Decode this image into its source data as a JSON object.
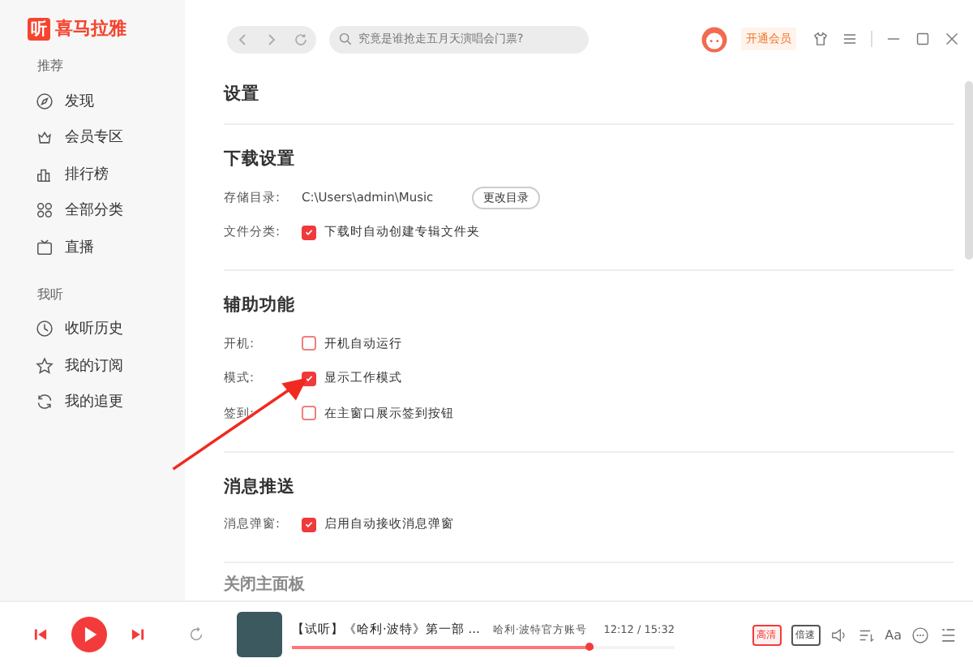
{
  "app": {
    "logo_mark": "听",
    "logo_text": "喜马拉雅"
  },
  "sidebar": {
    "groups": [
      {
        "title": "推荐",
        "items": [
          {
            "label": "发现",
            "selected": false
          },
          {
            "label": "会员专区",
            "selected": false
          },
          {
            "label": "排行榜",
            "selected": false
          },
          {
            "label": "全部分类",
            "selected": false
          },
          {
            "label": "直播",
            "selected": false
          }
        ]
      },
      {
        "title": "我听",
        "items": [
          {
            "label": "收听历史",
            "selected": false
          },
          {
            "label": "我的订阅",
            "selected": false
          },
          {
            "label": "我的追更",
            "selected": false
          }
        ]
      }
    ]
  },
  "topbar": {
    "search": {
      "placeholder": "究竟是谁抢走五月天演唱会门票?"
    },
    "vip_button": "开通会员"
  },
  "settings": {
    "title": "设置",
    "sections": [
      {
        "title": "下载设置",
        "rows": [
          {
            "kind": "path",
            "label": "存储目录:",
            "value": "C:\\Users\\admin\\Music",
            "button": "更改目录"
          },
          {
            "kind": "checkbox",
            "label": "文件分类:",
            "text": "下载时自动创建专辑文件夹",
            "checked": true
          }
        ]
      },
      {
        "title": "辅助功能",
        "rows": [
          {
            "kind": "checkbox",
            "label": "开机:",
            "text": "开机自动运行",
            "checked": false
          },
          {
            "kind": "checkbox",
            "label": "模式:",
            "text": "显示工作模式",
            "checked": true
          },
          {
            "kind": "checkbox",
            "label": "签到:",
            "text": "在主窗口展示签到按钮",
            "checked": false
          }
        ]
      },
      {
        "title": "消息推送",
        "rows": [
          {
            "kind": "checkbox",
            "label": "消息弹窗:",
            "text": "启用自动接收消息弹窗",
            "checked": true
          }
        ]
      }
    ],
    "next_section_title": "关闭主面板"
  },
  "player": {
    "title": "【试听】《哈利·波特》第一部 ...",
    "artist": "哈利·波特官方账号",
    "time": "12:12 / 15:32",
    "level": 0.79,
    "quality": "高清",
    "speed": "倍速",
    "font_button": "Aa"
  }
}
